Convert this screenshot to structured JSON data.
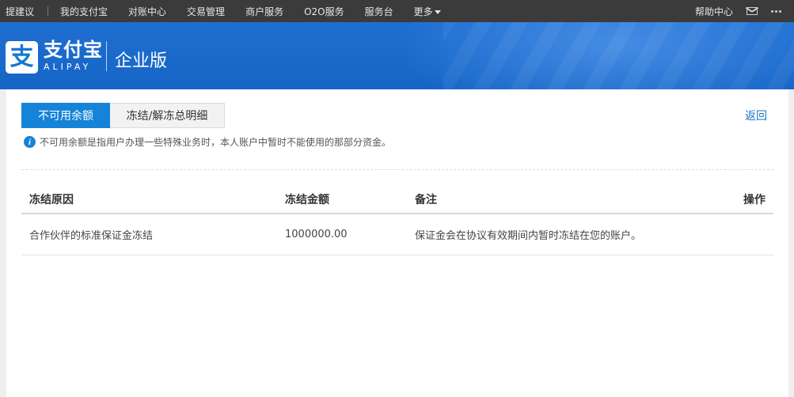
{
  "topnav": {
    "suggest": "提建议",
    "items": [
      "我的支付宝",
      "对账中心",
      "交易管理",
      "商户服务",
      "O2O服务",
      "服务台",
      "更多"
    ],
    "help": "帮助中心",
    "icons": [
      "mail-icon",
      "more-dots-icon"
    ]
  },
  "header": {
    "logo_glyph": "支",
    "brand_cn": "支付宝",
    "brand_en": "ALIPAY",
    "edition": "企业版"
  },
  "tabs": [
    {
      "label": "不可用余额",
      "active": true
    },
    {
      "label": "冻结/解冻总明细",
      "active": false
    }
  ],
  "back_label": "返回",
  "hint": {
    "icon": "i",
    "text": "不可用余额是指用户办理一些特殊业务时，本人账户中暂时不能使用的那部分资金。"
  },
  "table": {
    "columns": [
      "冻结原因",
      "冻结金额",
      "备注",
      "操作"
    ],
    "rows": [
      {
        "reason": "合作伙伴的标准保证金冻结",
        "amount": "1000000.00",
        "note": "保证金会在协议有效期间内暂时冻结在您的账户。",
        "action": ""
      }
    ]
  },
  "colors": {
    "topnav_bg": "#3b3b3b",
    "banner_blue": "#1565c7",
    "accent": "#1583d8",
    "link": "#1a73c4"
  }
}
